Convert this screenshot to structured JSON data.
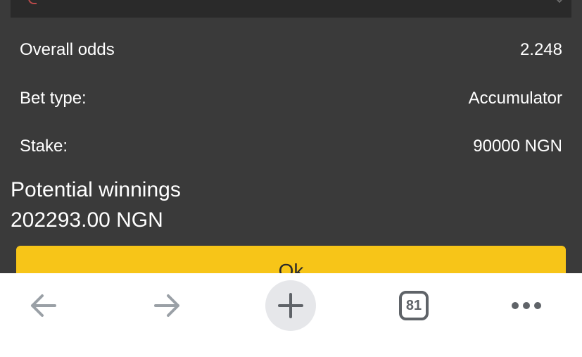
{
  "bet_summary": {
    "overall_odds_label": "Overall odds",
    "overall_odds_value": "2.248",
    "bet_type_label": "Bet type:",
    "bet_type_value": "Accumulator",
    "stake_label": "Stake:",
    "stake_value": "90000 NGN",
    "potential_winnings_label": "Potential winnings",
    "potential_winnings_value": "202293.00 NGN",
    "ok_label": "Ok"
  },
  "browser_toolbar": {
    "tab_count": "81",
    "icons": [
      "arrow-left-icon",
      "arrow-right-icon",
      "plus-icon",
      "tab-switcher-icon",
      "more-dots-icon"
    ]
  },
  "colors": {
    "panel_bg": "#3a3a3a",
    "accent_yellow": "#f7c518",
    "toolbar_icon": "#5f6368"
  }
}
